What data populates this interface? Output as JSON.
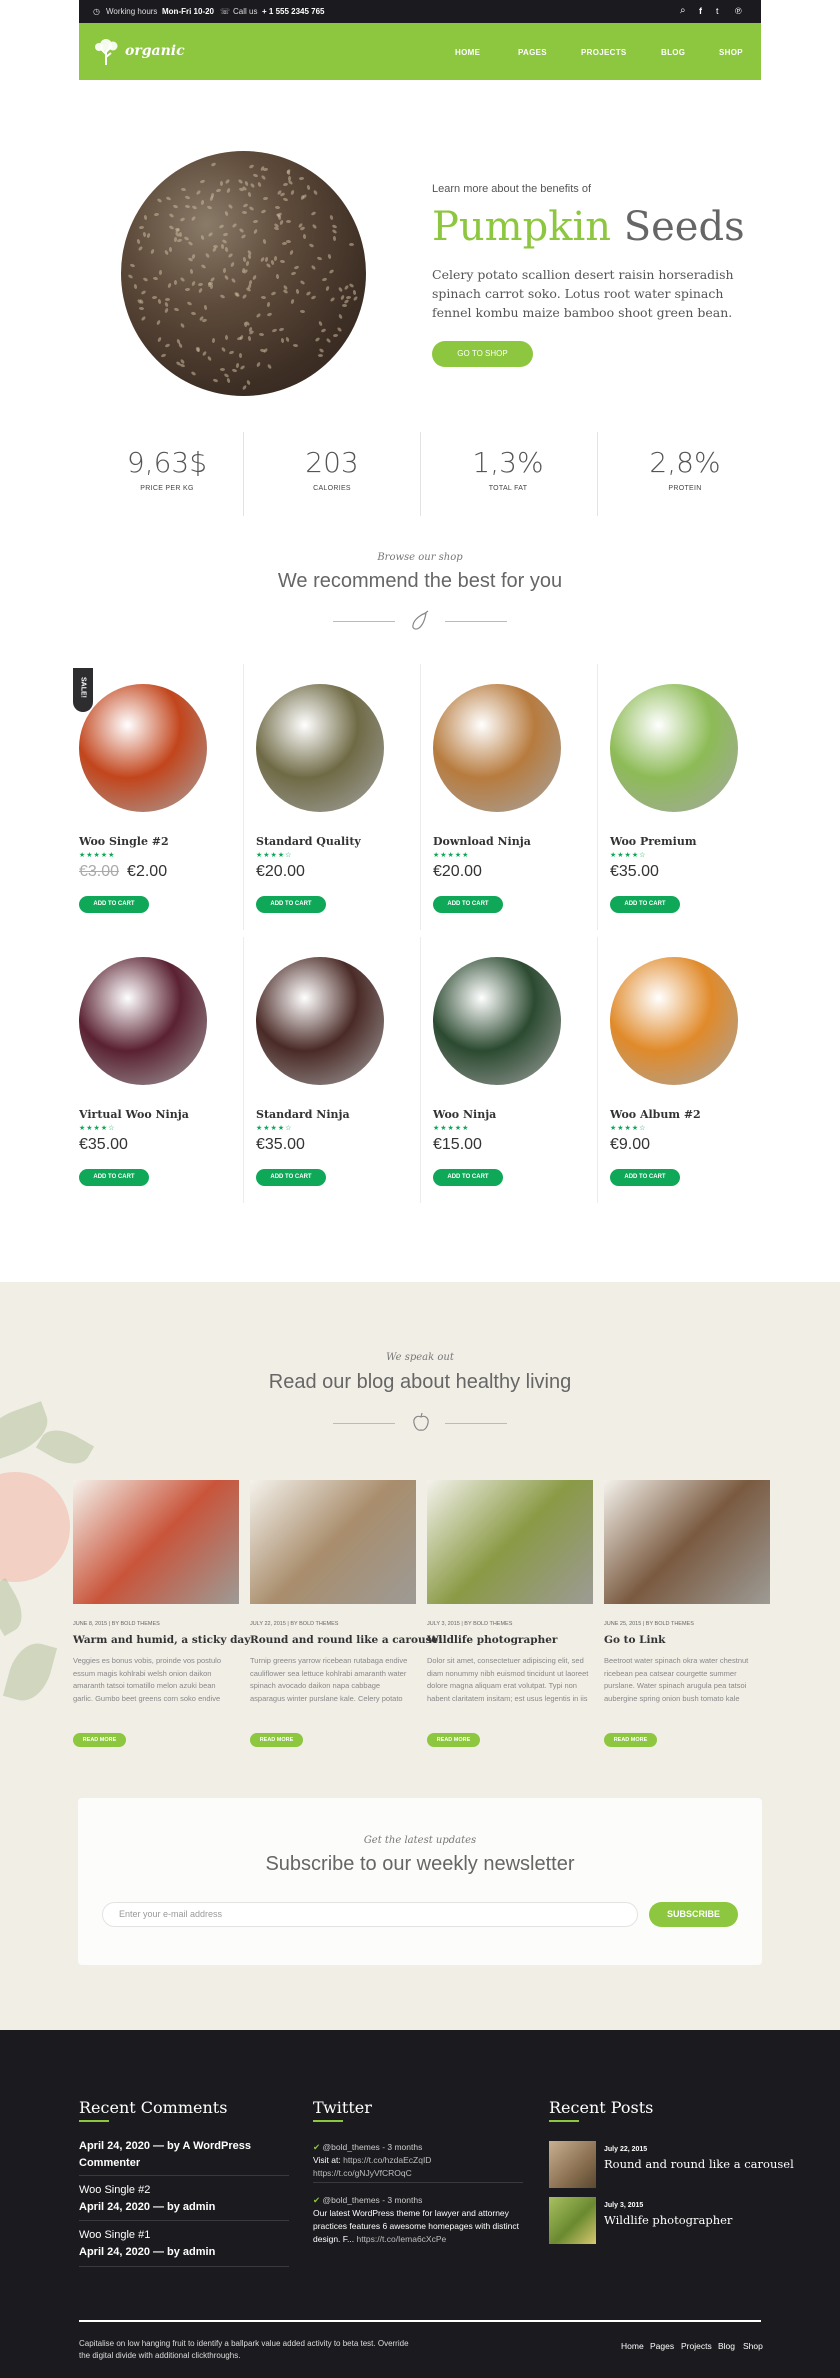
{
  "topbar": {
    "hours_label": "Working hours",
    "hours_value": "Mon-Fri 10-20",
    "call_label": "Call us",
    "call_value": "+ 1 555 2345 765"
  },
  "nav": {
    "logo": "organic",
    "items": [
      "HOME",
      "PAGES",
      "PROJECTS",
      "BLOG",
      "SHOP"
    ]
  },
  "hero": {
    "kicker": "Learn more about the benefits of",
    "title_highlight": "Pumpkin",
    "title_rest": "Seeds",
    "description": "Celery potato scallion desert raisin horseradish spinach carrot soko. Lotus root water spinach fennel kombu maize bamboo shoot green bean.",
    "button": "GO TO SHOP"
  },
  "stats": [
    {
      "value": "9,63$",
      "label": "PRICE PER KG"
    },
    {
      "value": "203",
      "label": "CALORIES"
    },
    {
      "value": "1,3%",
      "label": "TOTAL FAT"
    },
    {
      "value": "2,8%",
      "label": "PROTEIN"
    }
  ],
  "shop": {
    "kicker": "Browse our shop",
    "heading": "We recommend the best for you",
    "sale_tag": "SALE!",
    "add_to_cart": "ADD TO CART",
    "products": [
      {
        "name": "Woo Single #2",
        "old_price": "€3.00",
        "price": "€2.00",
        "stars": "★★★★★",
        "color": "#c2451c"
      },
      {
        "name": "Standard Quality",
        "price": "€20.00",
        "stars": "★★★★☆",
        "color": "#6f6a45"
      },
      {
        "name": "Download Ninja",
        "price": "€20.00",
        "stars": "★★★★★",
        "color": "#b77b3e"
      },
      {
        "name": "Woo Premium",
        "price": "€35.00",
        "stars": "★★★★☆",
        "color": "#8dbb56"
      },
      {
        "name": "Virtual Woo Ninja",
        "price": "€35.00",
        "stars": "★★★★☆",
        "color": "#5a2132"
      },
      {
        "name": "Standard Ninja",
        "price": "€35.00",
        "stars": "★★★★☆",
        "color": "#4a2a26"
      },
      {
        "name": "Woo Ninja",
        "price": "€15.00",
        "stars": "★★★★★",
        "color": "#2b4a30"
      },
      {
        "name": "Woo Album #2",
        "price": "€9.00",
        "stars": "★★★★☆",
        "color": "#e08a2a"
      }
    ]
  },
  "blog": {
    "kicker": "We speak out",
    "heading": "Read our blog about healthy living",
    "read_more": "READ MORE",
    "posts": [
      {
        "meta": "JUNE 8, 2015 | BY BOLD THEMES",
        "title": "Warm and humid, a sticky day",
        "excerpt": "Veggies es bonus vobis, proinde vos postulo essum magis kohlrabi welsh onion daikon amaranth tatsoi tomatillo melon azuki bean garlic. Gumbo beet greens corn soko endive gumbo gourd. Parsley shallot courgette tatsoi.",
        "color": "#c9543a"
      },
      {
        "meta": "JULY 22, 2015 | BY BOLD THEMES",
        "title": "Round and round like a carousel",
        "excerpt": "Turnip greens yarrow ricebean rutabaga endive cauliflower sea lettuce kohlrabi amaranth water spinach avocado daikon napa cabbage asparagus winter purslane kale. Celery potato scallion desert raisin horseradish spinach.",
        "color": "#a98d6c"
      },
      {
        "meta": "JULY 3, 2015 | BY BOLD THEMES",
        "title": "Wildlife photographer",
        "excerpt": "Dolor sit amet, consectetuer adipiscing elit, sed diam nonummy nibh euismod tincidunt ut laoreet dolore magna aliquam erat volutpat. Typi non habent claritatem insitam; est usus legentis in iis qui facit eorum claritatem.",
        "color": "#8a9a45"
      },
      {
        "meta": "JUNE 25, 2015 | BY BOLD THEMES",
        "title": "Go to Link",
        "excerpt": "Beetroot water spinach okra water chestnut ricebean pea catsear courgette summer purslane. Water spinach arugula pea tatsoi aubergine spring onion bush tomato kale radicchio turnip chicory salsify pea sprouts fav.",
        "color": "#7a5a40"
      }
    ]
  },
  "newsletter": {
    "kicker": "Get the latest updates",
    "heading": "Subscribe to our weekly newsletter",
    "placeholder": "Enter your e-mail address",
    "button": "SUBSCRIBE"
  },
  "footer": {
    "comments_heading": "Recent Comments",
    "comments": [
      {
        "line1": "April 24, 2020 — by A WordPress Commenter"
      },
      {
        "title": "Woo Single #2",
        "line": "April 24, 2020 — by admin"
      },
      {
        "title": "Woo Single #1",
        "line": "April 24, 2020 — by admin"
      }
    ],
    "twitter_heading": "Twitter",
    "tweets": [
      {
        "handle": "@bold_themes",
        "time": "- 3 months",
        "visit": "Visit at:",
        "link1": "https://t.co/hzdaEcZqID",
        "link2": "https://t.co/gNJyVfCROqC"
      },
      {
        "handle": "@bold_themes",
        "time": "- 3 months",
        "text": "Our latest WordPress theme for lawyer and attorney practices features 6 awesome homepages with distinct design. F...",
        "link": "https://t.co/Iema6cXcPe"
      }
    ],
    "posts_heading": "Recent Posts",
    "recent_posts": [
      {
        "date": "July 22, 2015",
        "title": "Round and round like a carousel"
      },
      {
        "date": "July 3, 2015",
        "title": "Wildlife photographer"
      }
    ],
    "copyright": "Capitalise on low hanging fruit to identify a ballpark value added activity to beta test. Override the digital divide with additional clickthroughs.",
    "menu": [
      "Home",
      "Pages",
      "Projects",
      "Blog",
      "Shop"
    ]
  },
  "colors": {
    "accent": "#8dc63f",
    "cart": "#0fa858",
    "dark": "#1b1b1f",
    "blog_bg": "#f1eee6"
  }
}
